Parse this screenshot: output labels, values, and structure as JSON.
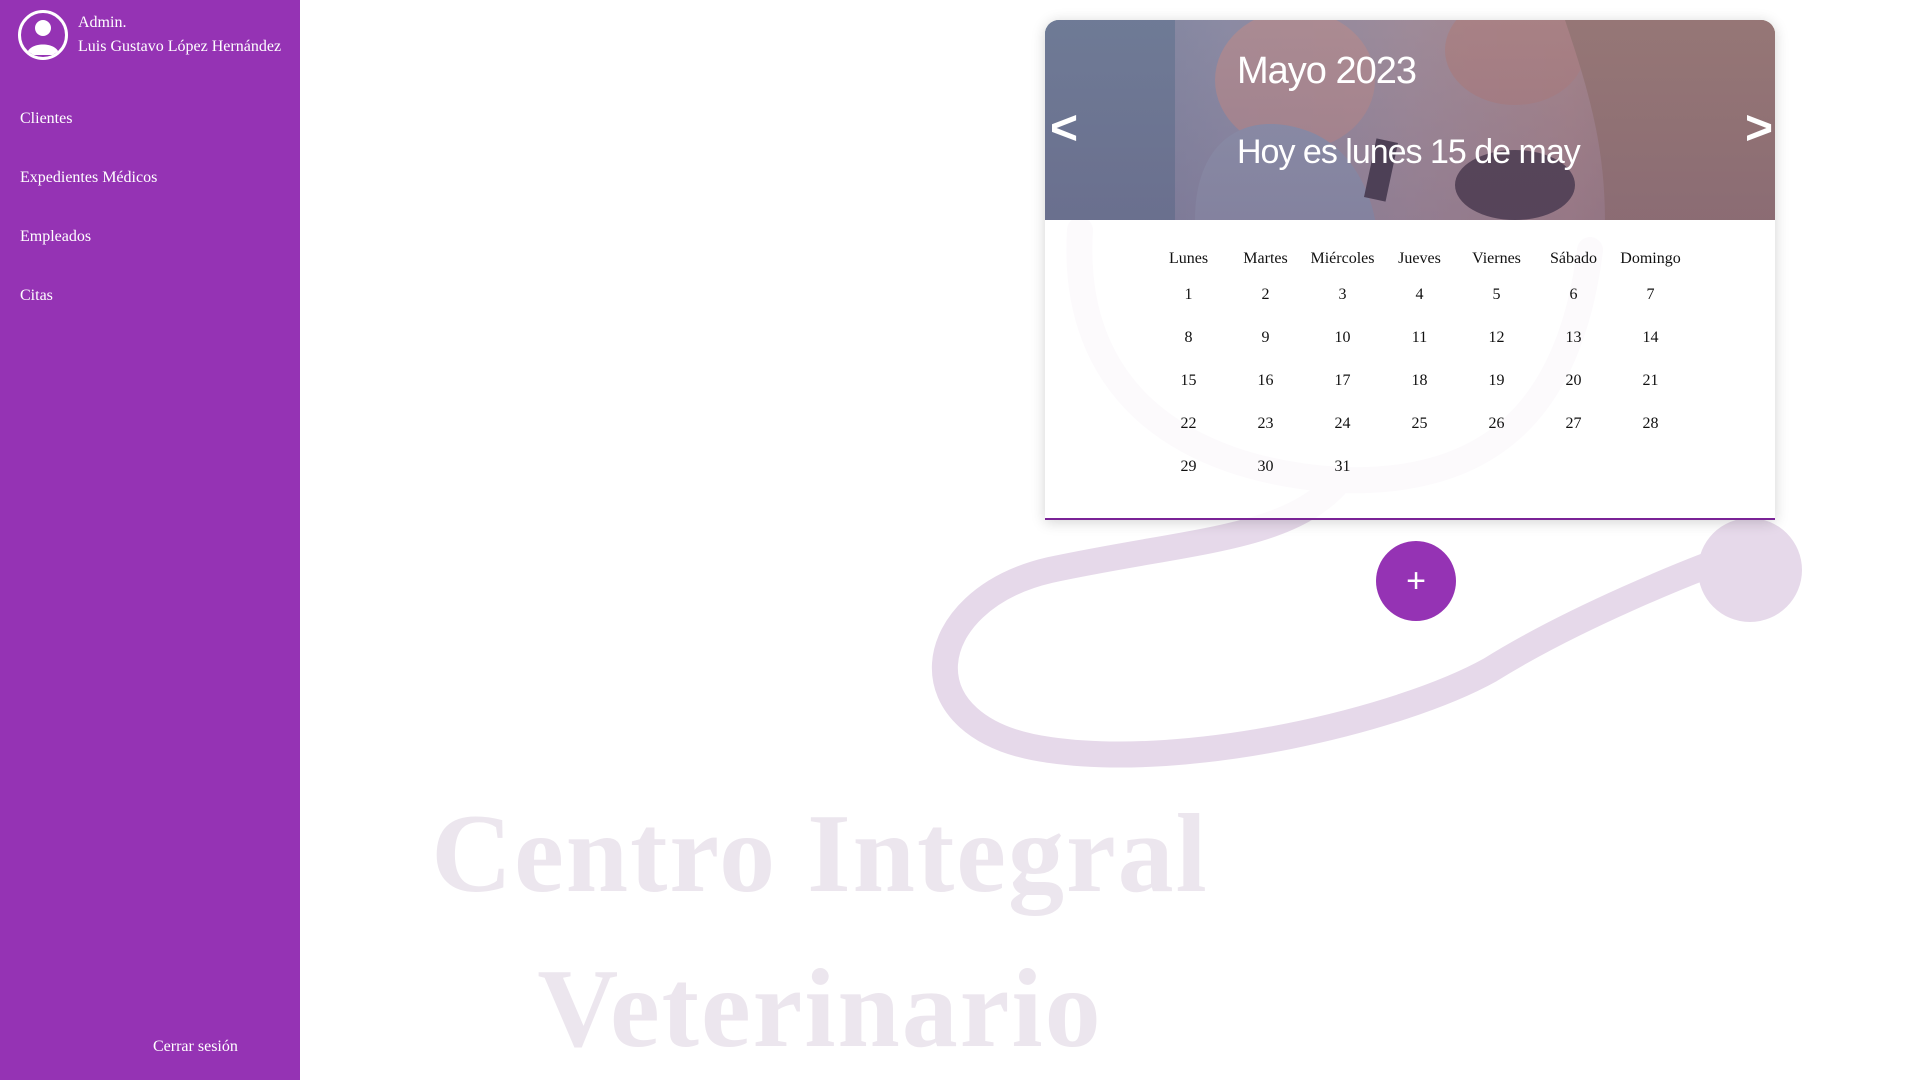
{
  "sidebar": {
    "user_role": "Admin.",
    "user_name": "Luis Gustavo López Hernández",
    "nav": [
      {
        "label": "Clientes"
      },
      {
        "label": "Expedientes Médicos"
      },
      {
        "label": "Empleados"
      },
      {
        "label": "Citas"
      }
    ],
    "logout_label": "Cerrar sesión",
    "accent_color": "#9533b4"
  },
  "watermark": {
    "line1": "Centro Integral",
    "line2": "Veterinario"
  },
  "calendar": {
    "month_title": "Mayo 2023",
    "today_text": "Hoy es lunes 15 de may",
    "prev_label": "<",
    "next_label": ">",
    "weekdays": [
      "Lunes",
      "Martes",
      "Miércoles",
      "Jueves",
      "Viernes",
      "Sábado",
      "Domingo"
    ],
    "weeks": [
      [
        "1",
        "2",
        "3",
        "4",
        "5",
        "6",
        "7"
      ],
      [
        "8",
        "9",
        "10",
        "11",
        "12",
        "13",
        "14"
      ],
      [
        "15",
        "16",
        "17",
        "18",
        "19",
        "20",
        "21"
      ],
      [
        "22",
        "23",
        "24",
        "25",
        "26",
        "27",
        "28"
      ],
      [
        "29",
        "30",
        "31",
        "",
        "",
        "",
        ""
      ]
    ]
  },
  "add_button_label": "+"
}
